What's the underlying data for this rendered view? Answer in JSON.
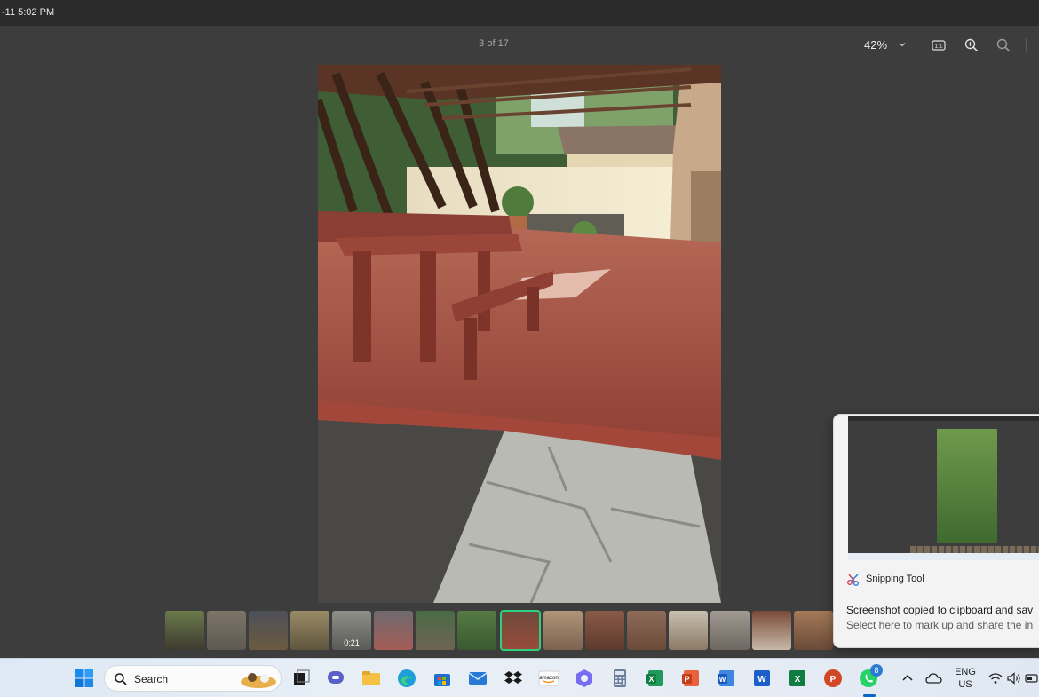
{
  "titlebar": {
    "time_fragment": "-11 5:02 PM"
  },
  "viewer": {
    "counter": "3 of 17",
    "zoom": "42%",
    "icons": [
      "actual-size-icon",
      "zoom-in-icon",
      "zoom-out-icon"
    ]
  },
  "filmstrip": {
    "selected_index": 8,
    "video_duration": "0:21"
  },
  "toast": {
    "app_name": "Snipping Tool",
    "message": "Screenshot copied to clipboard and sav",
    "subtext": "Select here to mark up and share the in"
  },
  "taskbar": {
    "search_label": "Search",
    "whatsapp_badge": "8",
    "lang_line1": "ENG",
    "lang_line2": "US"
  },
  "colors": {
    "accent_green": "#2fd07b",
    "taskbar_bg": "#e6ecf4",
    "viewer_bg": "#3d3d3d"
  }
}
